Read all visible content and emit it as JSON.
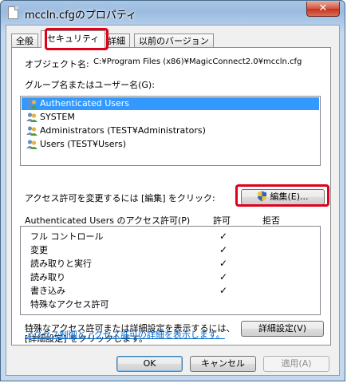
{
  "window": {
    "title": "mccln.cfgのプロパティ",
    "close_label": "✕"
  },
  "tabs": [
    {
      "label": "全般",
      "active": false
    },
    {
      "label": "セキュリティ",
      "active": true
    },
    {
      "label": "詳細",
      "active": false
    },
    {
      "label": "以前のバージョン",
      "active": false
    }
  ],
  "object": {
    "label": "オブジェクト名:",
    "path": "C:¥Program Files (x86)¥MagicConnect2.0¥mccln.cfg"
  },
  "groups": {
    "label": "グループ名またはユーザー名(G):",
    "items": [
      {
        "name": "Authenticated Users",
        "selected": true
      },
      {
        "name": "SYSTEM",
        "selected": false
      },
      {
        "name": "Administrators (TEST¥Administrators)",
        "selected": false
      },
      {
        "name": "Users (TEST¥Users)",
        "selected": false
      }
    ]
  },
  "change_perm": {
    "label": "アクセス許可を変更するには [編集] をクリック:",
    "edit_button": "編集(E)..."
  },
  "permissions": {
    "header": "Authenticated Users のアクセス許可(P)",
    "allow_header": "許可",
    "deny_header": "拒否",
    "check_mark": "✓",
    "rows": [
      {
        "name": "フル コントロール",
        "allow": true,
        "deny": false
      },
      {
        "name": "変更",
        "allow": true,
        "deny": false
      },
      {
        "name": "読み取りと実行",
        "allow": true,
        "deny": false
      },
      {
        "name": "読み取り",
        "allow": true,
        "deny": false
      },
      {
        "name": "書き込み",
        "allow": true,
        "deny": false
      },
      {
        "name": "特殊なアクセス許可",
        "allow": false,
        "deny": false
      }
    ]
  },
  "advanced": {
    "text_line1": "特殊なアクセス許可または詳細設定を表示するには、",
    "text_line2": "[詳細設定] をクリックします。",
    "button": "詳細設定(V)"
  },
  "link": {
    "text": "アクセス制御とアクセス許可の詳細を表示します。"
  },
  "footer": {
    "ok": "OK",
    "cancel": "キャンセル",
    "apply": "適用(A)"
  },
  "colors": {
    "selection": "#3399ff",
    "link": "#0066cc",
    "highlight": "#e0001a"
  }
}
